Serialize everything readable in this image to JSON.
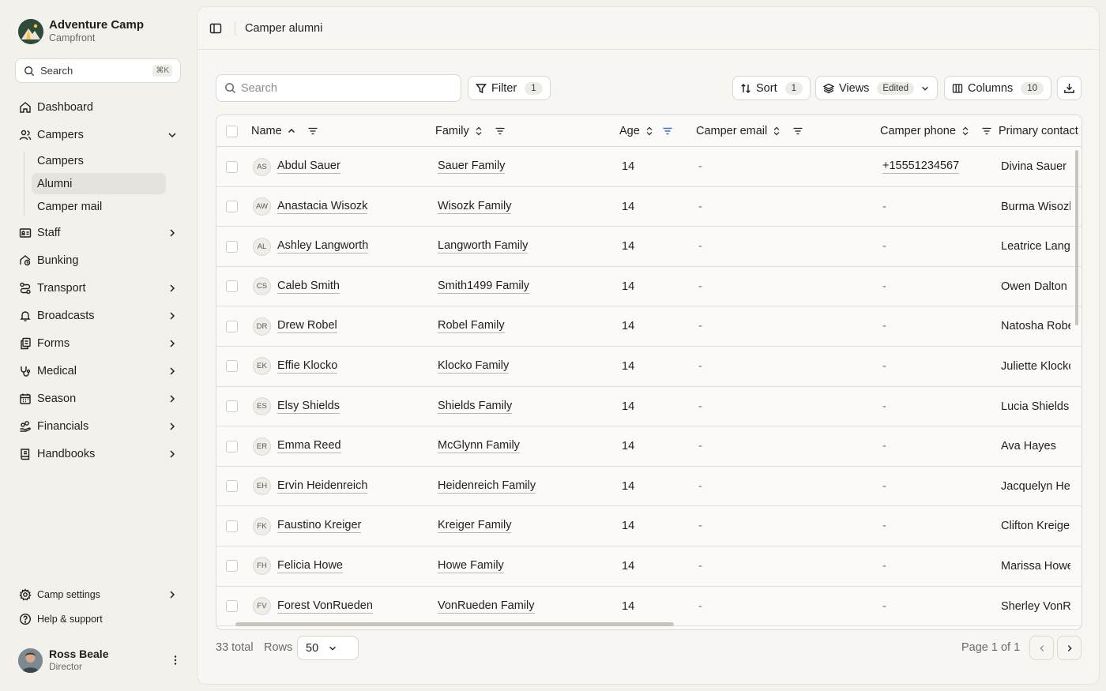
{
  "brand": {
    "name": "Adventure Camp",
    "sub": "Campfront"
  },
  "sidebar": {
    "search_label": "Search",
    "search_shortcut": "⌘K",
    "items": [
      {
        "label": "Dashboard",
        "icon": "home-icon"
      },
      {
        "label": "Campers",
        "icon": "users-icon",
        "expanded": true,
        "children": [
          {
            "label": "Campers"
          },
          {
            "label": "Alumni",
            "active": true
          },
          {
            "label": "Camper mail"
          }
        ]
      },
      {
        "label": "Staff",
        "icon": "id-card-icon"
      },
      {
        "label": "Bunking",
        "icon": "bunk-icon"
      },
      {
        "label": "Transport",
        "icon": "route-icon"
      },
      {
        "label": "Broadcasts",
        "icon": "bell-icon"
      },
      {
        "label": "Forms",
        "icon": "forms-icon"
      },
      {
        "label": "Medical",
        "icon": "stethoscope-icon"
      },
      {
        "label": "Season",
        "icon": "calendar-icon"
      },
      {
        "label": "Financials",
        "icon": "hand-coins-icon"
      },
      {
        "label": "Handbooks",
        "icon": "book-icon"
      }
    ],
    "bottom": [
      {
        "label": "Camp settings",
        "icon": "gear-icon"
      },
      {
        "label": "Help & support",
        "icon": "help-icon"
      }
    ]
  },
  "user": {
    "name": "Ross Beale",
    "role": "Director"
  },
  "header": {
    "title": "Camper alumni"
  },
  "toolbar": {
    "search_placeholder": "Search",
    "filter_label": "Filter",
    "filter_count": "1",
    "sort_label": "Sort",
    "sort_count": "1",
    "views_label": "Views",
    "views_badge": "Edited",
    "columns_label": "Columns",
    "columns_count": "10"
  },
  "table": {
    "columns": [
      "Name",
      "Family",
      "Age",
      "Camper email",
      "Camper phone",
      "Primary contact"
    ],
    "rows": [
      {
        "initials": "AS",
        "name": "Abdul Sauer",
        "family": "Sauer Family",
        "age": "14",
        "email": "-",
        "phone": "+15551234567",
        "contact": "Divina Sauer"
      },
      {
        "initials": "AW",
        "name": "Anastacia Wisozk",
        "family": "Wisozk Family",
        "age": "14",
        "email": "-",
        "phone": "-",
        "contact": "Burma Wisozk"
      },
      {
        "initials": "AL",
        "name": "Ashley Langworth",
        "family": "Langworth Family",
        "age": "14",
        "email": "-",
        "phone": "-",
        "contact": "Leatrice Langworth"
      },
      {
        "initials": "CS",
        "name": "Caleb Smith",
        "family": "Smith1499 Family",
        "age": "14",
        "email": "-",
        "phone": "-",
        "contact": "Owen Dalton"
      },
      {
        "initials": "DR",
        "name": "Drew Robel",
        "family": "Robel Family",
        "age": "14",
        "email": "-",
        "phone": "-",
        "contact": "Natosha Robel"
      },
      {
        "initials": "EK",
        "name": "Effie Klocko",
        "family": "Klocko Family",
        "age": "14",
        "email": "-",
        "phone": "-",
        "contact": "Juliette Klocko"
      },
      {
        "initials": "ES",
        "name": "Elsy Shields",
        "family": "Shields Family",
        "age": "14",
        "email": "-",
        "phone": "-",
        "contact": "Lucia Shields"
      },
      {
        "initials": "ER",
        "name": "Emma Reed",
        "family": "McGlynn Family",
        "age": "14",
        "email": "-",
        "phone": "-",
        "contact": "Ava Hayes"
      },
      {
        "initials": "EH",
        "name": "Ervin Heidenreich",
        "family": "Heidenreich Family",
        "age": "14",
        "email": "-",
        "phone": "-",
        "contact": "Jacquelyn Heidenreich"
      },
      {
        "initials": "FK",
        "name": "Faustino Kreiger",
        "family": "Kreiger Family",
        "age": "14",
        "email": "-",
        "phone": "-",
        "contact": "Clifton Kreiger"
      },
      {
        "initials": "FH",
        "name": "Felicia Howe",
        "family": "Howe Family",
        "age": "14",
        "email": "-",
        "phone": "-",
        "contact": "Marissa Howe"
      },
      {
        "initials": "FV",
        "name": "Forest VonRueden",
        "family": "VonRueden Family",
        "age": "14",
        "email": "-",
        "phone": "-",
        "contact": "Sherley VonRueden"
      }
    ]
  },
  "footer": {
    "total": "33 total",
    "rows_label": "Rows",
    "rows_value": "50",
    "page": "Page 1 of 1"
  },
  "colors": {
    "accent": "#3b6fd6",
    "bg": "#f3f1ec",
    "panel": "#f8f6f2"
  }
}
